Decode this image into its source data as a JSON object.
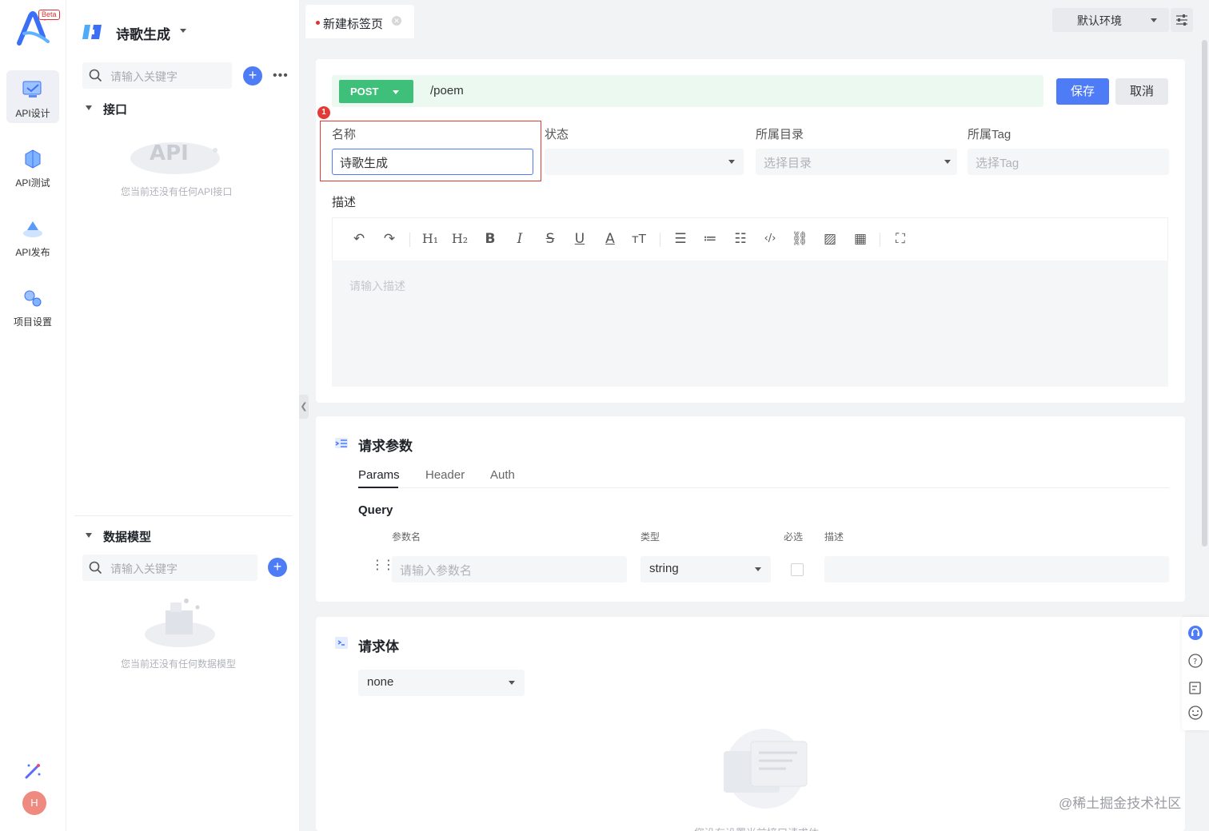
{
  "rail": {
    "beta": "Beta",
    "items": [
      {
        "label": "API设计",
        "icon": "api-design-icon",
        "active": true
      },
      {
        "label": "API测试",
        "icon": "api-test-icon",
        "active": false
      },
      {
        "label": "API发布",
        "icon": "api-publish-icon",
        "active": false
      },
      {
        "label": "项目设置",
        "icon": "project-settings-icon",
        "active": false
      }
    ],
    "avatar": "H"
  },
  "sidebar": {
    "project_name": "诗歌生成",
    "api_search_placeholder": "请输入关键字",
    "api_section": "接口",
    "api_empty": "您当前还没有任何API接口",
    "model_section": "数据模型",
    "model_search_placeholder": "请输入关键字",
    "model_empty": "您当前还没有任何数据模型"
  },
  "tabs": {
    "active_tab": "新建标签页",
    "env": "默认环境"
  },
  "request": {
    "method": "POST",
    "path": "/poem",
    "save": "保存",
    "cancel": "取消"
  },
  "form": {
    "badge": "1",
    "name_label": "名称",
    "name_value": "诗歌生成",
    "status_label": "状态",
    "dir_label": "所属目录",
    "dir_placeholder": "选择目录",
    "tag_label": "所属Tag",
    "tag_placeholder": "选择Tag",
    "desc_label": "描述",
    "desc_placeholder": "请输入描述"
  },
  "params": {
    "title": "请求参数",
    "tabs": [
      "Params",
      "Header",
      "Auth"
    ],
    "query_title": "Query",
    "columns": [
      "参数名",
      "类型",
      "必选",
      "描述"
    ],
    "name_placeholder": "请输入参数名",
    "type_value": "string"
  },
  "body": {
    "title": "请求体",
    "type_value": "none",
    "empty_text": "您没有设置当前接口请求体"
  },
  "watermark": "@稀土掘金技术社区",
  "colors": {
    "primary": "#4d7cf6",
    "post_green": "#3ec07a",
    "highlight_red": "#e53935"
  }
}
